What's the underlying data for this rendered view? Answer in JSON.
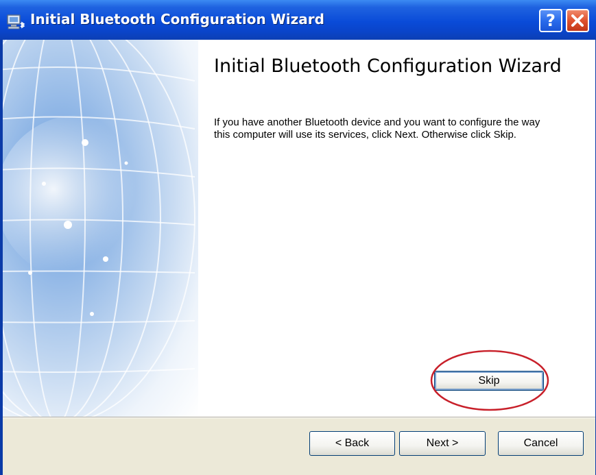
{
  "window": {
    "title": "Initial Bluetooth Configuration Wizard",
    "help_glyph": "?",
    "controls": [
      "help-icon",
      "close-icon"
    ]
  },
  "content": {
    "heading": "Initial Bluetooth Configuration Wizard",
    "description": "If you have another Bluetooth device and you want to configure the way this computer will use its services, click Next. Otherwise click Skip.",
    "skip_label": "Skip"
  },
  "footer": {
    "back_label": "< Back",
    "next_label": "Next >",
    "cancel_label": "Cancel"
  },
  "colors": {
    "titlebar": "#0a4bd8",
    "footer_bg": "#ece9d8",
    "close_button": "#e0522e",
    "callout_ring": "#c8202a"
  },
  "icons": [
    "bluetooth-computer-icon",
    "globe-graphic"
  ]
}
